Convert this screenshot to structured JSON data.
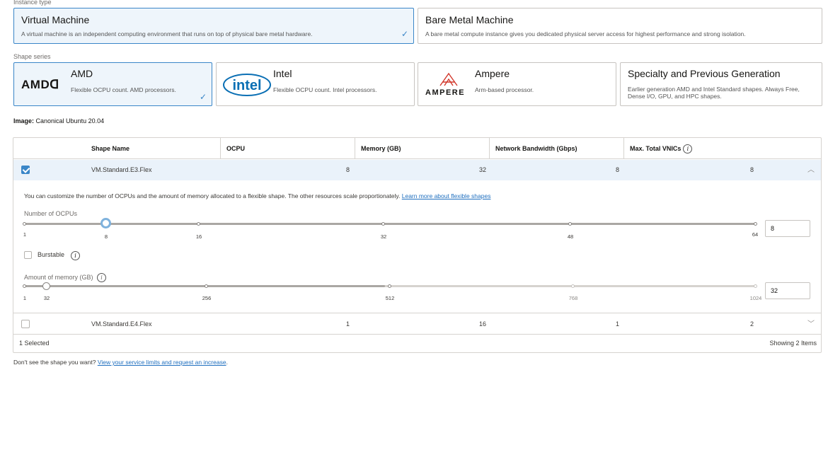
{
  "instance_type": {
    "label": "Instance type",
    "cards": [
      {
        "title": "Virtual Machine",
        "desc": "A virtual machine is an independent computing environment that runs on top of physical bare metal hardware.",
        "selected": true
      },
      {
        "title": "Bare Metal Machine",
        "desc": "A bare metal compute instance gives you dedicated physical server access for highest performance and strong isolation.",
        "selected": false
      }
    ]
  },
  "shape_series": {
    "label": "Shape series",
    "cards": [
      {
        "title": "AMD",
        "logo": "AMDᗡ",
        "desc": "Flexible OCPU count. AMD processors.",
        "selected": true
      },
      {
        "title": "Intel",
        "logo": "intel",
        "desc": "Flexible OCPU count. Intel processors.",
        "selected": false
      },
      {
        "title": "Ampere",
        "logo": "AMPERE",
        "desc": "Arm-based processor.",
        "selected": false
      },
      {
        "title": "Specialty and Previous Generation",
        "desc": "Earlier generation AMD and Intel Standard shapes. Always Free, Dense I/O, GPU, and HPC shapes.",
        "selected": false
      }
    ]
  },
  "image": {
    "label": "Image:",
    "value": "Canonical Ubuntu 20.04"
  },
  "table": {
    "headers": [
      "Shape Name",
      "OCPU",
      "Memory (GB)",
      "Network Bandwidth (Gbps)",
      "Max. Total VNICs"
    ],
    "rows": [
      {
        "name": "VM.Standard.E3.Flex",
        "ocpu": "8",
        "memory": "32",
        "bandwidth": "8",
        "vnics": "8",
        "checked": true,
        "expanded": true
      },
      {
        "name": "VM.Standard.E4.Flex",
        "ocpu": "1",
        "memory": "16",
        "bandwidth": "1",
        "vnics": "2",
        "checked": false,
        "expanded": false
      }
    ],
    "expand": {
      "info_text": "You can customize the number of OCPUs and the amount of memory allocated to a flexible shape. The other resources scale proportionately. ",
      "info_link": "Learn more about flexible shapes",
      "ocpu_slider": {
        "label": "Number of OCPUs",
        "min": 1,
        "max": 64,
        "value": 8,
        "ticks": [
          "1",
          "8",
          "16",
          "32",
          "48",
          "64"
        ],
        "input_value": "8"
      },
      "burstable_label": "Burstable",
      "memory_slider": {
        "label": "Amount of memory (GB)",
        "min": 1,
        "max": 1024,
        "value": 32,
        "ticks": [
          "1",
          "32",
          "256",
          "512",
          "768",
          "1024"
        ],
        "input_value": "32"
      }
    },
    "footer": {
      "selected": "1 Selected",
      "showing": "Showing 2 Items"
    }
  },
  "bottom_note": {
    "text": "Don't see the shape you want? ",
    "link": "View your service limits and request an increase",
    "suffix": "."
  },
  "colors": {
    "accent": "#3a86c8",
    "selected_bg": "#eef5fb",
    "link": "#1f6fbf"
  }
}
